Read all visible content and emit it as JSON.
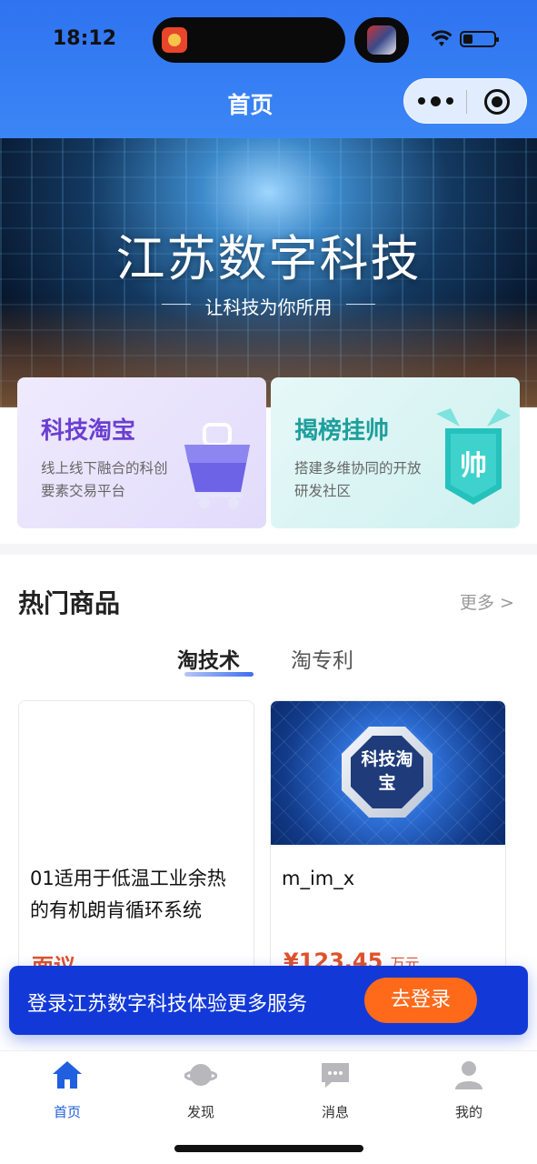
{
  "status_bar": {
    "time": "18:12"
  },
  "nav": {
    "title": "首页"
  },
  "banner": {
    "title": "江苏数字科技",
    "subtitle": "让科技为你所用"
  },
  "feature_cards": [
    {
      "title": "科技淘宝",
      "desc": "线上线下融合的科创要素交易平台",
      "icon": "shopping-cart-icon"
    },
    {
      "title": "揭榜挂帅",
      "desc": "搭建多维协同的开放研发社区",
      "icon": "shuai-badge-icon",
      "badge_text": "帅"
    }
  ],
  "hot_products": {
    "title": "热门商品",
    "more_label": "更多 >",
    "tabs": [
      {
        "label": "淘技术",
        "active": true
      },
      {
        "label": "淘专利",
        "active": false
      }
    ],
    "items": [
      {
        "name": "01适用于低温工业余热的有机朗肯循环系统",
        "price": "面议",
        "price_unit": "",
        "image_text": ""
      },
      {
        "name": "m_im_x",
        "price": "¥123.45",
        "price_unit": "万元",
        "image_text": "科技淘宝"
      }
    ]
  },
  "login_bar": {
    "text": "登录江苏数字科技体验更多服务",
    "button_label": "去登录"
  },
  "tabbar": [
    {
      "label": "首页",
      "icon": "home-icon",
      "active": true
    },
    {
      "label": "发现",
      "icon": "planet-icon",
      "active": false
    },
    {
      "label": "消息",
      "icon": "message-icon",
      "active": false
    },
    {
      "label": "我的",
      "icon": "user-icon",
      "active": false
    }
  ],
  "colors": {
    "primary": "#1f5fe0",
    "login_bar": "#1239d8",
    "accent_orange": "#ff6a1a",
    "price": "#e0532a"
  }
}
